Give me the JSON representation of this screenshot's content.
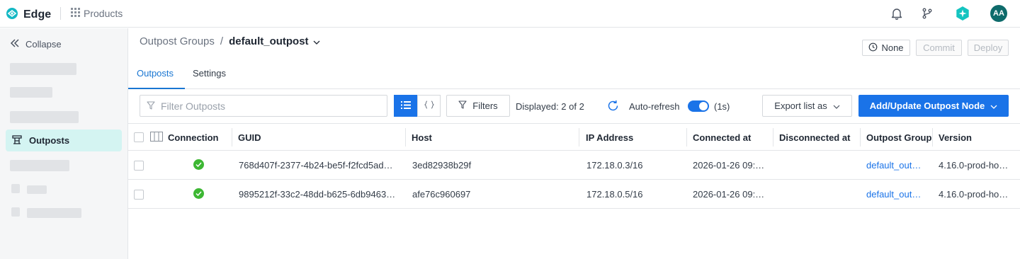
{
  "app": {
    "name": "Edge",
    "products_label": "Products",
    "avatar_initials": "AA"
  },
  "sidebar": {
    "collapse_label": "Collapse",
    "active_item": "Outposts"
  },
  "breadcrumb": {
    "parent": "Outpost Groups",
    "separator": "/",
    "current": "default_outpost"
  },
  "header_actions": {
    "none_label": "None",
    "commit_label": "Commit",
    "deploy_label": "Deploy"
  },
  "tabs": [
    {
      "label": "Outposts",
      "active": true
    },
    {
      "label": "Settings",
      "active": false
    }
  ],
  "toolbar": {
    "filter_placeholder": "Filter Outposts",
    "filters_label": "Filters",
    "displayed": "Displayed: 2 of 2",
    "auto_refresh_label": "Auto-refresh",
    "auto_refresh_on": true,
    "refresh_interval": "(1s)",
    "export_label": "Export list as",
    "add_update_label": "Add/Update Outpost Node"
  },
  "table": {
    "columns": [
      "Connection",
      "GUID",
      "Host",
      "IP Address",
      "Connected at",
      "Disconnected at",
      "Outpost Group",
      "Version"
    ],
    "rows": [
      {
        "connection": "connected",
        "guid": "768d407f-2377-4b24-be5f-f2fcd5ad…",
        "host": "3ed82938b29f",
        "ip": "172.18.0.3/16",
        "connected_at": "2026-01-26 09:…",
        "disconnected_at": "",
        "outpost_group": "default_out…",
        "version": "4.16.0-prod-ho…"
      },
      {
        "connection": "connected",
        "guid": "9895212f-33c2-48dd-b625-6db9463…",
        "host": "afe76c960697",
        "ip": "172.18.0.5/16",
        "connected_at": "2026-01-26 09:…",
        "disconnected_at": "",
        "outpost_group": "default_out…",
        "version": "4.16.0-prod-ho…"
      }
    ]
  },
  "colors": {
    "accent": "#1a73e8",
    "brand_teal": "#14b8c4",
    "active_nav_bg": "#d4f4f2",
    "success": "#3db733"
  },
  "icons": {
    "brand": "edge-logo-icon",
    "products": "grid-icon",
    "notifications": "bell-icon",
    "branch": "git-branch-icon",
    "assistant": "sparkle-icon",
    "collapse": "double-chevron-left-icon",
    "outposts": "outposts-icon",
    "dropdown": "chevron-down-icon",
    "history": "history-icon",
    "filter": "filter-icon",
    "list_view": "list-icon",
    "json_view": "braces-icon",
    "refresh": "refresh-icon",
    "columns": "columns-icon",
    "status_ok": "check-circle-icon"
  }
}
